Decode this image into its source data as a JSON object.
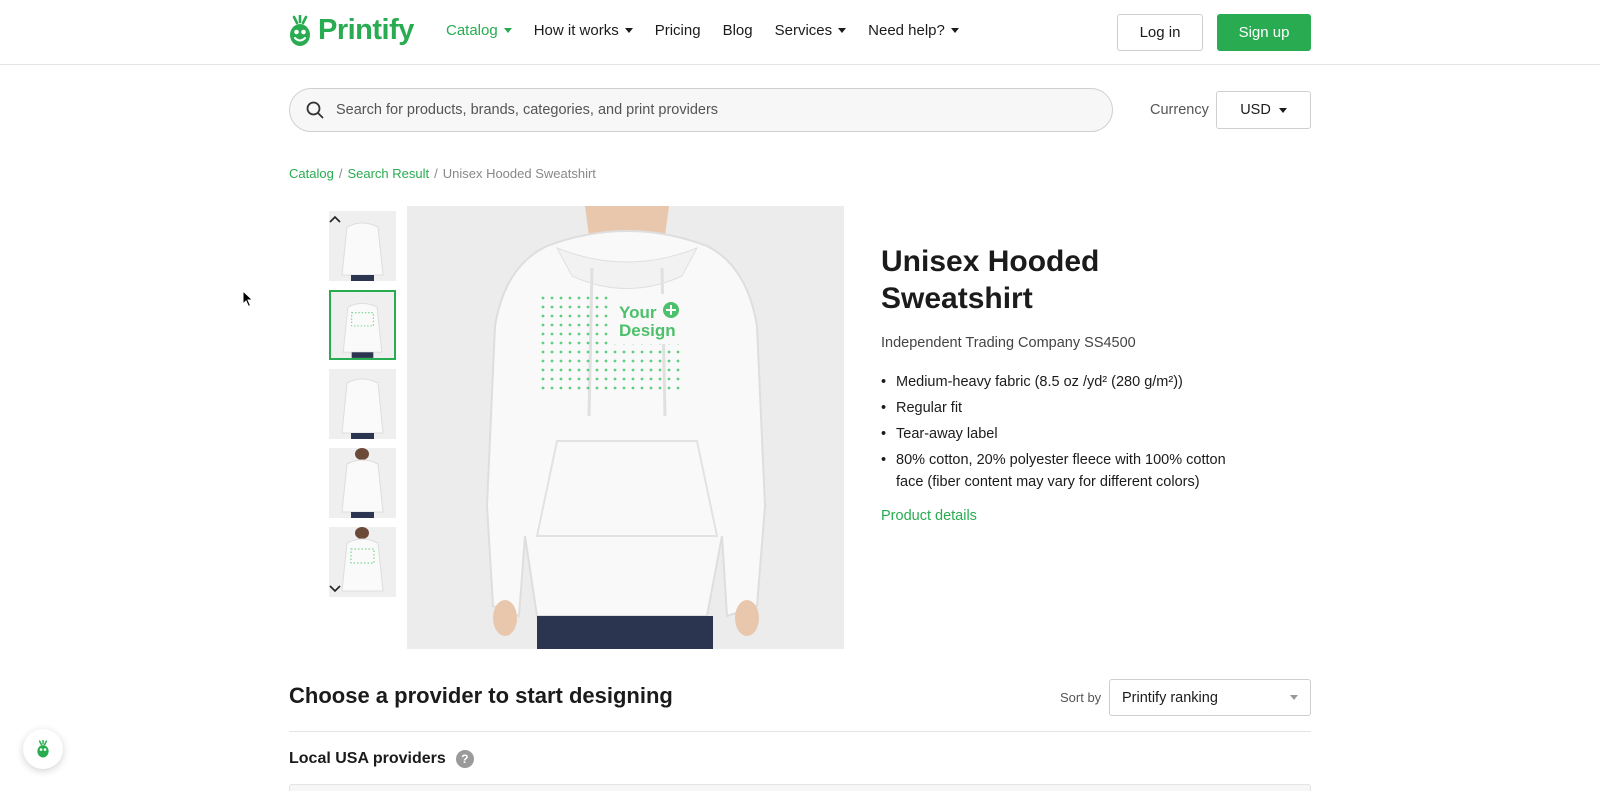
{
  "brand": {
    "name": "Printify",
    "color": "#29ab51"
  },
  "nav": {
    "items": [
      {
        "label": "Catalog",
        "dropdown": true,
        "active": true
      },
      {
        "label": "How it works",
        "dropdown": true
      },
      {
        "label": "Pricing",
        "dropdown": false
      },
      {
        "label": "Blog",
        "dropdown": false
      },
      {
        "label": "Services",
        "dropdown": true
      },
      {
        "label": "Need help?",
        "dropdown": true
      }
    ],
    "login_label": "Log in",
    "signup_label": "Sign up"
  },
  "search": {
    "placeholder": "Search for products, brands, categories, and print providers"
  },
  "currency": {
    "label": "Currency",
    "value": "USD"
  },
  "breadcrumb": {
    "items": [
      "Catalog",
      "Search Result"
    ],
    "current": "Unisex Hooded Sweatshirt",
    "separator": "/"
  },
  "gallery": {
    "thumbnails": [
      "hoodie-front",
      "hoodie-front-design",
      "hoodie-back",
      "hoodie-front-model",
      "hoodie-front-model-design"
    ],
    "selected_index": 1,
    "main_image": {
      "overlay_text": [
        "Your",
        "Design"
      ]
    }
  },
  "product": {
    "title": "Unisex Hooded Sweatshirt",
    "brand_model": "Independent Trading Company SS4500",
    "features": [
      "Medium-heavy fabric (8.5 oz /yd² (280 g/m²))",
      "Regular fit",
      "Tear-away label",
      "80% cotton, 20% polyester fleece with 100% cotton face (fiber content may vary for different colors)"
    ],
    "details_link": "Product details"
  },
  "providers": {
    "heading": "Choose a provider to start designing",
    "sort_label": "Sort by",
    "sort_value": "Printify ranking",
    "local_heading": "Local USA providers",
    "help_icon": "?"
  }
}
